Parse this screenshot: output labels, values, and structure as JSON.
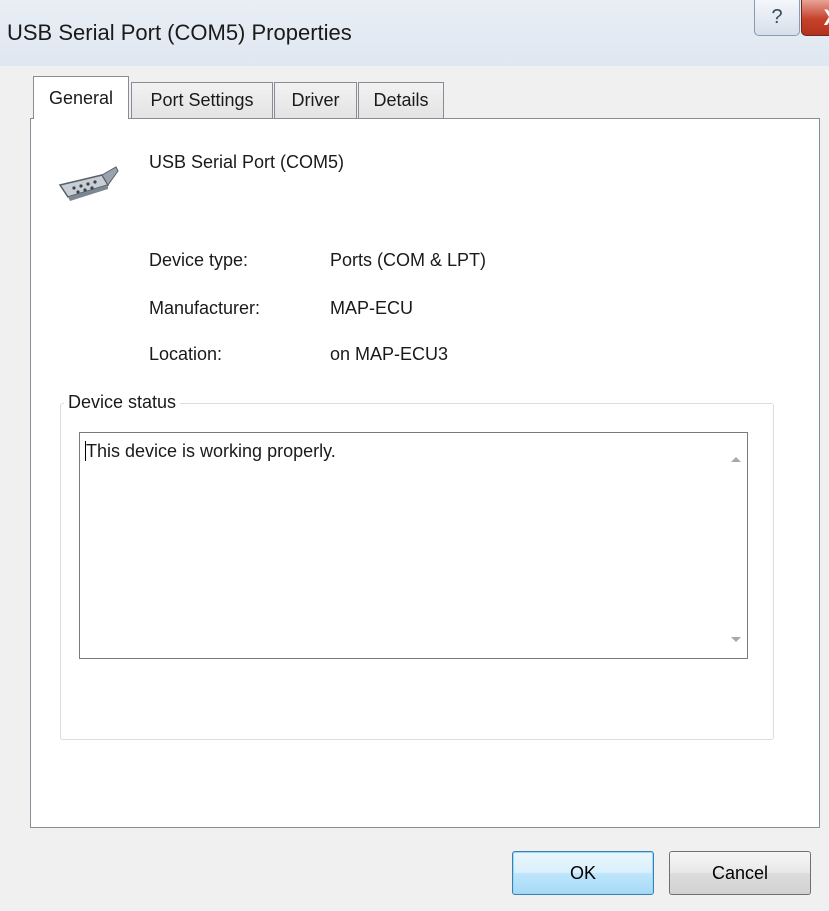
{
  "window": {
    "title": "USB Serial Port (COM5) Properties",
    "help_glyph": "?",
    "close_glyph": "X"
  },
  "tabs": [
    {
      "label": "General",
      "active": true
    },
    {
      "label": "Port Settings",
      "active": false
    },
    {
      "label": "Driver",
      "active": false
    },
    {
      "label": "Details",
      "active": false
    }
  ],
  "general": {
    "device_icon": "serial-port-connector-icon",
    "device_name": "USB Serial Port (COM5)",
    "properties": [
      {
        "label": "Device type:",
        "value": "Ports (COM & LPT)"
      },
      {
        "label": "Manufacturer:",
        "value": "MAP-ECU"
      },
      {
        "label": "Location:",
        "value": "on MAP-ECU3"
      }
    ],
    "device_status": {
      "legend": "Device status",
      "text": "This device is working properly."
    }
  },
  "buttons": {
    "ok": "OK",
    "cancel": "Cancel"
  },
  "colors": {
    "close_button": "#c4412b",
    "default_button_border": "#3c7fb1"
  }
}
